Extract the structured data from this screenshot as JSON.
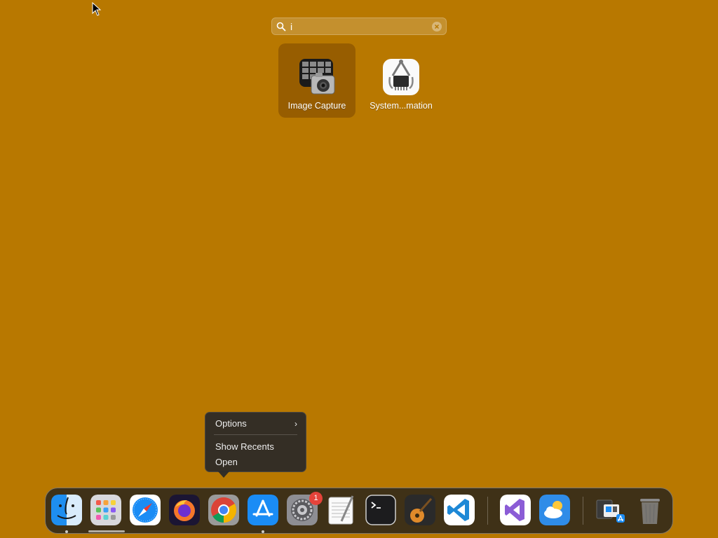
{
  "search": {
    "value": "i",
    "placeholder": ""
  },
  "results": [
    {
      "label": "Image Capture",
      "icon": "image-capture-icon",
      "selected": true
    },
    {
      "label": "System...mation",
      "icon": "system-information-icon",
      "selected": false
    }
  ],
  "context_menu": {
    "items": [
      {
        "label": "Options",
        "submenu": true
      },
      {
        "label": "Show Recents",
        "submenu": false
      },
      {
        "label": "Open",
        "submenu": false
      }
    ]
  },
  "dock": {
    "apps": [
      {
        "name": "finder",
        "icon": "finder-icon",
        "running": true
      },
      {
        "name": "launchpad",
        "icon": "launchpad-icon",
        "running": false
      },
      {
        "name": "safari",
        "icon": "safari-icon",
        "running": false
      },
      {
        "name": "firefox",
        "icon": "firefox-icon",
        "running": false
      },
      {
        "name": "chrome",
        "icon": "chrome-icon",
        "running": false
      },
      {
        "name": "app-store",
        "icon": "app-store-icon",
        "running": true
      },
      {
        "name": "system-preferences",
        "icon": "gear-icon",
        "running": false,
        "badge": "1"
      },
      {
        "name": "textedit",
        "icon": "textedit-icon",
        "running": false
      },
      {
        "name": "terminal",
        "icon": "terminal-icon",
        "running": false
      },
      {
        "name": "garageband",
        "icon": "guitar-icon",
        "running": false
      },
      {
        "name": "vscode",
        "icon": "vscode-icon",
        "running": false
      },
      {
        "name": "visual-studio",
        "icon": "visual-studio-icon",
        "running": false
      },
      {
        "name": "weather",
        "icon": "weather-icon",
        "running": false
      },
      {
        "name": "downloads",
        "icon": "downloads-stack-icon",
        "running": false
      },
      {
        "name": "trash",
        "icon": "trash-icon",
        "running": false
      }
    ]
  },
  "colors": {
    "desktop": "#B87800",
    "badge": "#E5433A",
    "selection": "#6E3C00"
  }
}
